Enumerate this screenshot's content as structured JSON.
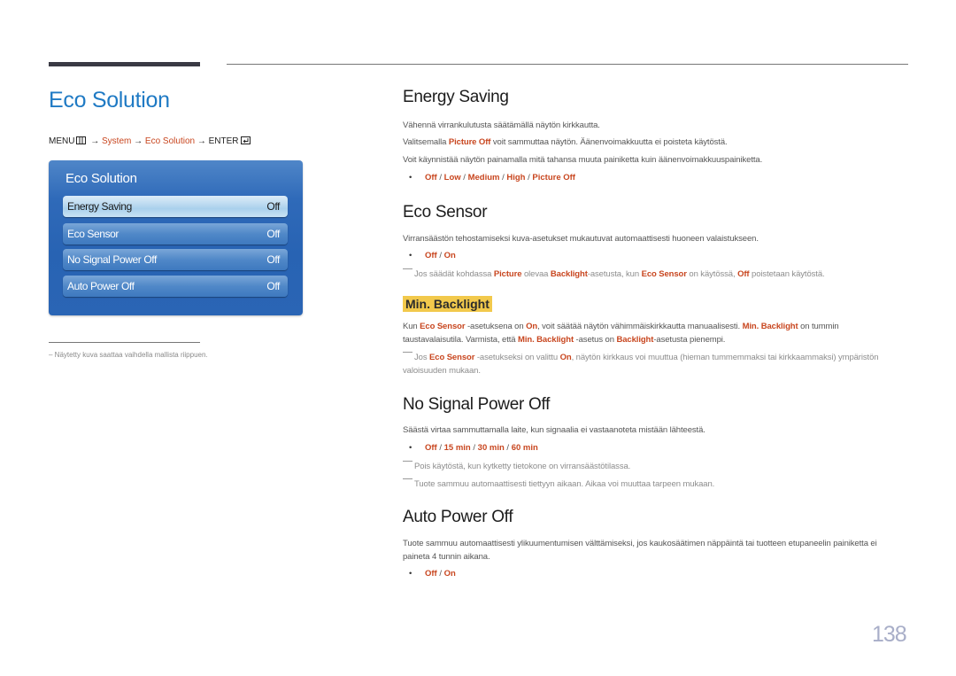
{
  "page": {
    "title": "Eco Solution",
    "page_number": "138"
  },
  "breadcrumb": {
    "menu": "MENU",
    "menu_icon": "menu-grid-icon",
    "arrow": "→",
    "system": "System",
    "eco_solution": "Eco Solution",
    "enter": "ENTER",
    "enter_icon": "enter-icon"
  },
  "osd": {
    "title": "Eco Solution",
    "items": [
      {
        "label": "Energy Saving",
        "value": "Off",
        "selected": true
      },
      {
        "label": "Eco Sensor",
        "value": "Off",
        "selected": false
      },
      {
        "label": "No Signal Power Off",
        "value": "Off",
        "selected": false
      },
      {
        "label": "Auto Power Off",
        "value": "Off",
        "selected": false
      }
    ]
  },
  "footnote": "–  Näytetty kuva saattaa vaihdella mallista riippuen.",
  "sections": {
    "energy_saving": {
      "heading": "Energy Saving",
      "p1": "Vähennä virrankulutusta säätämällä näytön kirkkautta.",
      "p2_a": "Valitsemalla ",
      "p2_b": "Picture Off",
      "p2_c": " voit sammuttaa näytön. Äänenvoimakkuutta ei poisteta käytöstä.",
      "p3": "Voit käynnistää näytön painamalla mitä tahansa muuta painiketta kuin äänenvoimakkuuspainiketta.",
      "options": [
        "Off",
        "Low",
        "Medium",
        "High",
        "Picture Off"
      ]
    },
    "eco_sensor": {
      "heading": "Eco Sensor",
      "p1": "Virransäästön tehostamiseksi kuva-asetukset mukautuvat automaattisesti huoneen valaistukseen.",
      "options": [
        "Off",
        "On"
      ],
      "note_a": "Jos säädät kohdassa ",
      "note_b": "Picture",
      "note_c": " olevaa ",
      "note_d": "Backlight",
      "note_e": "-asetusta, kun ",
      "note_f": "Eco Sensor",
      "note_g": " on käytössä, ",
      "note_h": "Off",
      "note_i": " poistetaan käytöstä."
    },
    "min_backlight": {
      "heading": "Min. Backlight",
      "p_a": "Kun ",
      "p_b": "Eco Sensor",
      "p_c": " -asetuksena on ",
      "p_d": "On",
      "p_e": ", voit säätää näytön vähimmäiskirkkautta manuaalisesti. ",
      "p_f": "Min. Backlight",
      "p_g": " on tummin taustavalaisutila. Varmista, että ",
      "p_h": "Min. Backlight",
      "p_i": " -asetus on ",
      "p_j": "Backlight",
      "p_k": "-asetusta pienempi.",
      "note_a": "Jos ",
      "note_b": "Eco Sensor",
      "note_c": " -asetukseksi on valittu ",
      "note_d": "On",
      "note_e": ", näytön kirkkaus voi muuttua (hieman tummemmaksi tai kirkkaammaksi) ympäristön valoisuuden mukaan."
    },
    "no_signal": {
      "heading": "No Signal Power Off",
      "p1": "Säästä virtaa sammuttamalla laite, kun signaalia ei vastaanoteta mistään lähteestä.",
      "options": [
        "Off",
        "15 min",
        "30 min",
        "60 min"
      ],
      "note1": "Pois käytöstä, kun kytketty tietokone on virransäästötilassa.",
      "note2": "Tuote sammuu automaattisesti tiettyyn aikaan. Aikaa voi muuttaa tarpeen mukaan."
    },
    "auto_power_off": {
      "heading": "Auto Power Off",
      "p1": "Tuote sammuu automaattisesti ylikuumentumisen välttämiseksi, jos kaukosäätimen näppäintä tai tuotteen etupaneelin painiketta ei paineta 4 tunnin aikana.",
      "options": [
        "Off",
        "On"
      ]
    }
  },
  "colors": {
    "title_blue": "#1f7ac4",
    "highlight_orange": "#c8461f",
    "subheading_yellow": "#f2c94c",
    "osd_blue": "#2863b3"
  }
}
